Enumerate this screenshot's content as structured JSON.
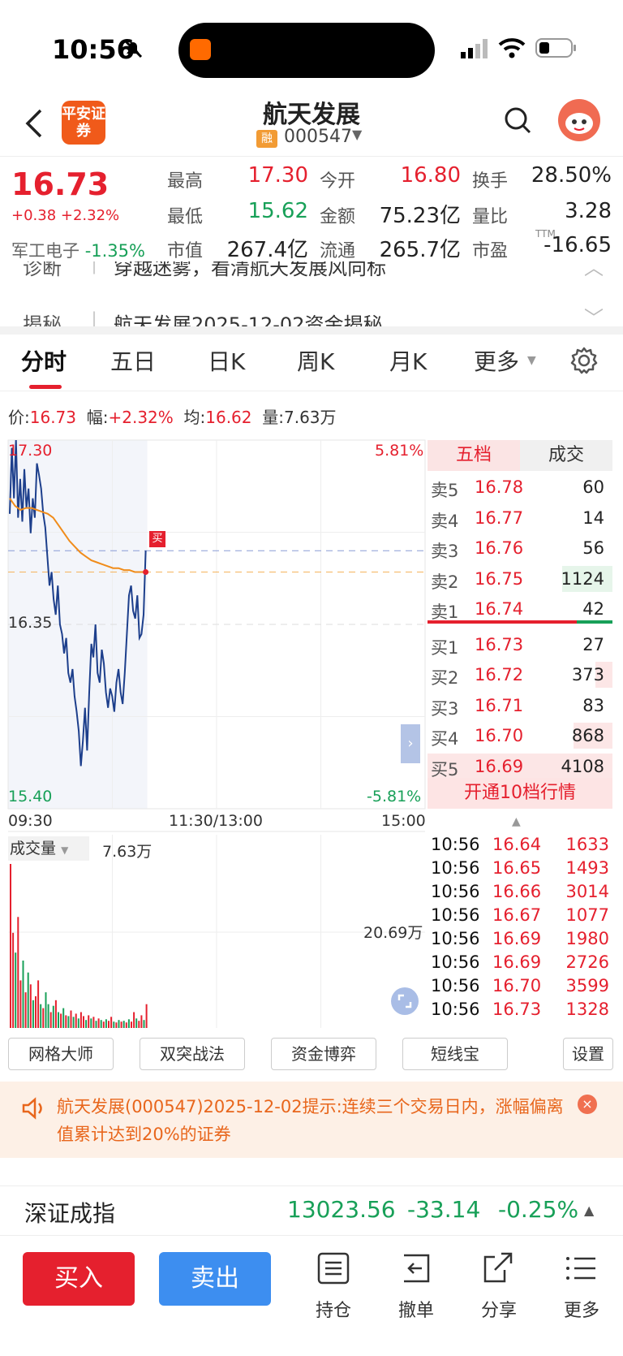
{
  "status_bar": {
    "time": "10:56"
  },
  "header": {
    "broker_logo": "平安证券",
    "stock_name": "航天发展",
    "margin_badge": "融",
    "stock_code": "000547"
  },
  "quote": {
    "price": "16.73",
    "change": "+0.38 +2.32%",
    "sector_name": "军工电子",
    "sector_change": "-1.35%",
    "stats": [
      {
        "label": "最高",
        "value": "17.30",
        "tone": "red"
      },
      {
        "label": "今开",
        "value": "16.80",
        "tone": "red"
      },
      {
        "label": "换手",
        "value": "28.50%",
        "tone": "black"
      },
      {
        "label": "最低",
        "value": "15.62",
        "tone": "green"
      },
      {
        "label": "金额",
        "value": "75.23亿",
        "tone": "black"
      },
      {
        "label": "量比",
        "value": "3.28",
        "tone": "black"
      },
      {
        "label": "市值",
        "value": "267.4亿",
        "tone": "black"
      },
      {
        "label": "流通",
        "value": "265.7亿",
        "tone": "black"
      },
      {
        "label": "市盈",
        "value": "-16.65",
        "tone": "black"
      }
    ],
    "pe_superscript": "TTM"
  },
  "strip": {
    "row1_label": "诊断",
    "row1_text": "穿越迷雾，看清航天发展风向标",
    "row2_label": "揭秘",
    "row2_text": "航天发展2025-12-02资金揭秘"
  },
  "tabs": [
    "分时",
    "五日",
    "日K",
    "周K",
    "月K",
    "更多"
  ],
  "info_line": {
    "price_label": "价:",
    "price": "16.73",
    "amp_label": "幅:",
    "amp": "+2.32%",
    "avg_label": "均:",
    "avg": "16.62",
    "vol_label": "量:",
    "vol": "7.63万"
  },
  "chart": {
    "y_high": "17.30",
    "y_mid": "16.35",
    "y_low": "15.40",
    "pct_high": "5.81%",
    "pct_low": "-5.81%",
    "x_start": "09:30",
    "x_mid": "11:30/13:00",
    "x_end": "15:00",
    "buy_marker": "买",
    "volume_label": "成交量",
    "volume_value": "7.63万",
    "volume_max": "20.69万"
  },
  "chart_data": {
    "type": "line",
    "price_range": [
      15.4,
      17.3
    ],
    "prev_close": 16.35,
    "price_series": [
      16.92,
      17.26,
      17.0,
      17.3,
      16.9,
      17.1,
      16.88,
      17.15,
      16.95,
      17.05,
      16.82,
      17.0,
      16.9,
      17.18,
      17.12,
      17.05,
      16.92,
      16.85,
      16.7,
      16.55,
      16.62,
      16.48,
      16.4,
      16.55,
      16.35,
      16.3,
      16.2,
      16.28,
      16.1,
      16.05,
      16.12,
      15.98,
      15.9,
      15.8,
      15.62,
      15.75,
      15.92,
      15.7,
      16.0,
      16.25,
      16.18,
      16.35,
      16.1,
      16.05,
      16.22,
      16.15,
      16.0,
      15.92,
      16.02,
      15.98,
      15.9,
      16.05,
      16.12,
      16.0,
      15.94,
      16.1,
      16.3,
      16.5,
      16.55,
      16.42,
      16.38,
      16.5,
      16.28,
      16.3,
      16.4,
      16.73
    ],
    "avg_series": [
      17.0,
      16.96,
      16.94,
      16.95,
      16.95,
      16.94,
      16.93,
      16.92,
      16.9,
      16.86,
      16.82,
      16.78,
      16.75,
      16.72,
      16.7,
      16.68,
      16.67,
      16.66,
      16.65,
      16.64,
      16.64,
      16.63,
      16.63,
      16.62,
      16.62,
      16.62
    ],
    "volume_series": [
      20.69,
      12.0,
      9.5,
      14.0,
      6.0,
      8.5,
      4.5,
      7.0,
      5.5,
      3.5,
      4.0,
      6.0,
      3.0,
      2.5,
      4.5,
      3.0,
      2.0,
      2.8,
      3.5,
      2.0,
      1.8,
      2.5,
      1.6,
      1.5,
      2.2,
      1.4,
      1.8,
      1.2,
      2.0,
      1.5,
      1.0,
      1.6,
      1.2,
      1.4,
      0.9,
      1.2,
      1.0,
      0.8,
      1.1,
      0.9,
      1.4,
      0.8,
      0.7,
      1.0,
      0.8,
      0.9,
      0.7,
      1.1,
      0.8,
      2.0,
      1.2,
      0.9,
      1.6,
      1.0,
      3.0
    ],
    "volume_colors": [
      "r",
      "r",
      "g",
      "r",
      "r",
      "g",
      "r",
      "g",
      "r",
      "g",
      "r",
      "r",
      "g",
      "r",
      "g",
      "g",
      "r",
      "g",
      "r",
      "g",
      "r",
      "g",
      "r",
      "g",
      "r",
      "g",
      "r",
      "g",
      "r",
      "r",
      "g",
      "r",
      "g",
      "r",
      "g",
      "r",
      "g",
      "r",
      "g",
      "r",
      "r",
      "g",
      "r",
      "g",
      "r",
      "g",
      "r",
      "g",
      "r",
      "r",
      "g",
      "r",
      "r",
      "g",
      "r"
    ]
  },
  "orderbook": {
    "tab_active": "五档",
    "tab_other": "成交",
    "asks": [
      {
        "label": "卖5",
        "price": "16.78",
        "vol": "60",
        "bar": 0.0
      },
      {
        "label": "卖4",
        "price": "16.77",
        "vol": "14",
        "bar": 0.0
      },
      {
        "label": "卖3",
        "price": "16.76",
        "vol": "56",
        "bar": 0.0
      },
      {
        "label": "卖2",
        "price": "16.75",
        "vol": "1124",
        "bar": 0.27
      },
      {
        "label": "卖1",
        "price": "16.74",
        "vol": "42",
        "bar": 0.0
      }
    ],
    "bids": [
      {
        "label": "买1",
        "price": "16.73",
        "vol": "27",
        "bar": 0.0
      },
      {
        "label": "买2",
        "price": "16.72",
        "vol": "373",
        "bar": 0.09
      },
      {
        "label": "买3",
        "price": "16.71",
        "vol": "83",
        "bar": 0.0
      },
      {
        "label": "买4",
        "price": "16.70",
        "vol": "868",
        "bar": 0.21
      },
      {
        "label": "买5",
        "price": "16.69",
        "vol": "4108",
        "bar": 1.0
      }
    ],
    "upgrade_text": "开通10档行情",
    "trades": [
      {
        "time": "10:56",
        "price": "16.64",
        "vol": "1633"
      },
      {
        "time": "10:56",
        "price": "16.65",
        "vol": "1493"
      },
      {
        "time": "10:56",
        "price": "16.66",
        "vol": "3014"
      },
      {
        "time": "10:56",
        "price": "16.67",
        "vol": "1077"
      },
      {
        "time": "10:56",
        "price": "16.69",
        "vol": "1980"
      },
      {
        "time": "10:56",
        "price": "16.69",
        "vol": "2726"
      },
      {
        "time": "10:56",
        "price": "16.70",
        "vol": "3599"
      },
      {
        "time": "10:56",
        "price": "16.73",
        "vol": "1328"
      }
    ]
  },
  "tools": [
    "网格大师",
    "双突战法",
    "资金博弈",
    "短线宝",
    "设置"
  ],
  "alert": {
    "text": "航天发展(000547)2025-12-02提示:连续三个交易日内，涨幅偏离值累计达到20%的证券"
  },
  "index_bar": {
    "name": "深证成指",
    "value": "13023.56",
    "change": "-33.14",
    "change_pct": "-0.25%"
  },
  "bottom_nav": {
    "buy": "买入",
    "sell": "卖出",
    "items": [
      "持仓",
      "撤单",
      "分享",
      "更多"
    ]
  },
  "colors": {
    "up": "#e5202e",
    "down": "#18a058",
    "price_line": "#1d3f8c",
    "avg_line": "#f08c1a",
    "buy_button": "#e5202e",
    "sell_button": "#3d8ef0"
  }
}
